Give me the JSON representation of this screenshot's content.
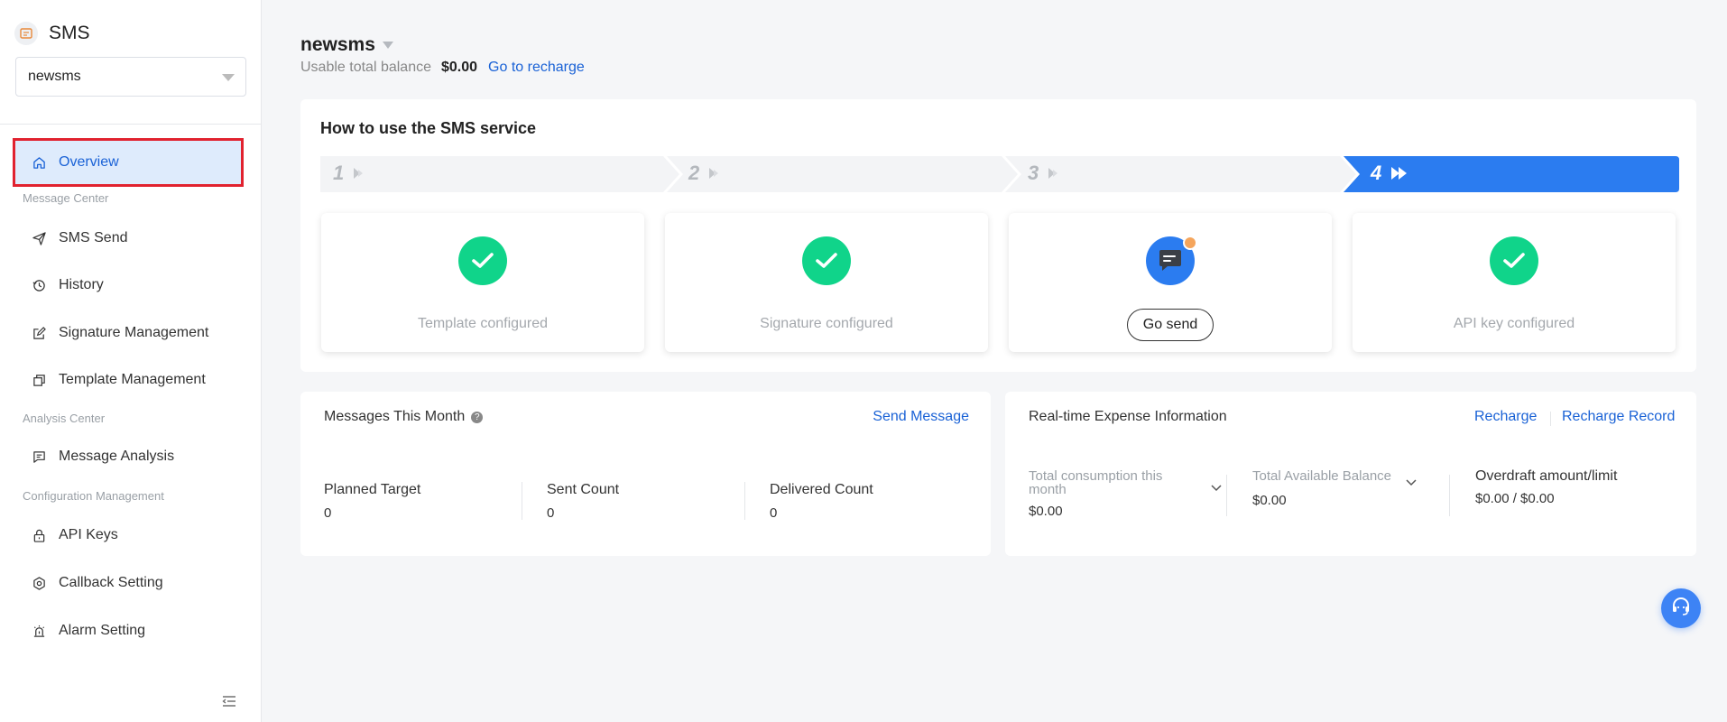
{
  "sidebar": {
    "brand_title": "SMS",
    "app_select_value": "newsms",
    "items": [
      {
        "label": "Overview"
      },
      {
        "label": "SMS Send"
      },
      {
        "label": "History"
      },
      {
        "label": "Signature Management"
      },
      {
        "label": "Template Management"
      },
      {
        "label": "Message Analysis"
      },
      {
        "label": "API Keys"
      },
      {
        "label": "Callback Setting"
      },
      {
        "label": "Alarm Setting"
      }
    ],
    "groups": [
      "Message Center",
      "Analysis Center",
      "Configuration Management"
    ]
  },
  "header": {
    "app_name": "newsms",
    "balance_label": "Usable total balance",
    "balance_value": "$0.00",
    "recharge_link": "Go to recharge"
  },
  "guide": {
    "title": "How to use the SMS service",
    "steps": [
      "1",
      "2",
      "3",
      "4"
    ],
    "cards": [
      {
        "caption": "Template configured"
      },
      {
        "caption": "Signature configured"
      },
      {
        "button": "Go send"
      },
      {
        "caption": "API key configured"
      }
    ]
  },
  "messages": {
    "title": "Messages This Month",
    "send_link": "Send Message",
    "stats": [
      {
        "label": "Planned Target",
        "value": "0"
      },
      {
        "label": "Sent Count",
        "value": "0"
      },
      {
        "label": "Delivered Count",
        "value": "0"
      }
    ]
  },
  "expense": {
    "title": "Real-time Expense Information",
    "recharge_link": "Recharge",
    "record_link": "Recharge Record",
    "stats": [
      {
        "label": "Total consumption this month",
        "value": "$0.00"
      },
      {
        "label": "Total Available Balance",
        "value": "$0.00"
      },
      {
        "label": "Overdraft amount/limit",
        "value": "$0.00 / $0.00"
      }
    ]
  },
  "colors": {
    "accent": "#1a62d6",
    "success": "#10d48a",
    "active_step": "#2b7cf0",
    "highlight_border": "#e1222f"
  }
}
